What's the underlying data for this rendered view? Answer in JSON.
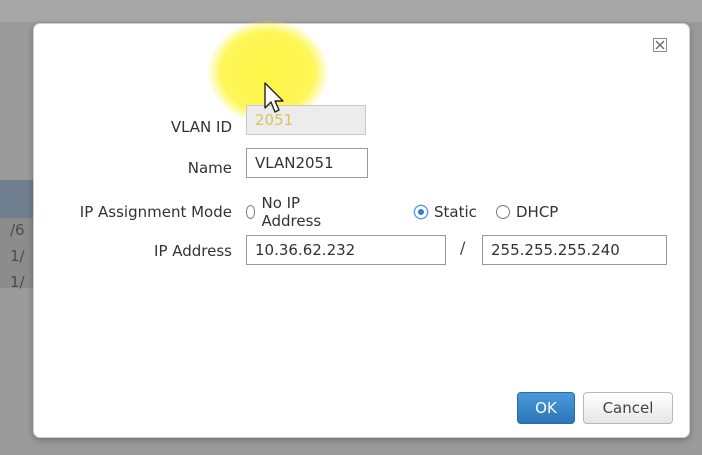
{
  "background": {
    "fragments": [
      "/6",
      "1/",
      "1/"
    ]
  },
  "dialog": {
    "close_icon": "close-icon",
    "fields": {
      "vlan_id_label": "VLAN ID",
      "vlan_id_value": "2051",
      "name_label": "Name",
      "name_value": "VLAN2051",
      "ip_mode_label": "IP Assignment Mode",
      "ip_address_label": "IP Address",
      "ip_address_value": "10.36.62.232",
      "subnet_separator": "/",
      "subnet_mask_value": "255.255.255.240"
    },
    "ip_modes": [
      {
        "label": "No IP Address",
        "selected": false
      },
      {
        "label": "Static",
        "selected": true
      },
      {
        "label": "DHCP",
        "selected": false
      }
    ],
    "buttons": {
      "ok_label": "OK",
      "cancel_label": "Cancel"
    }
  },
  "colors": {
    "primary_button": "#2d75b8",
    "cursor_highlight": "#fff53c",
    "radio_selected": "#2a7fd4"
  }
}
